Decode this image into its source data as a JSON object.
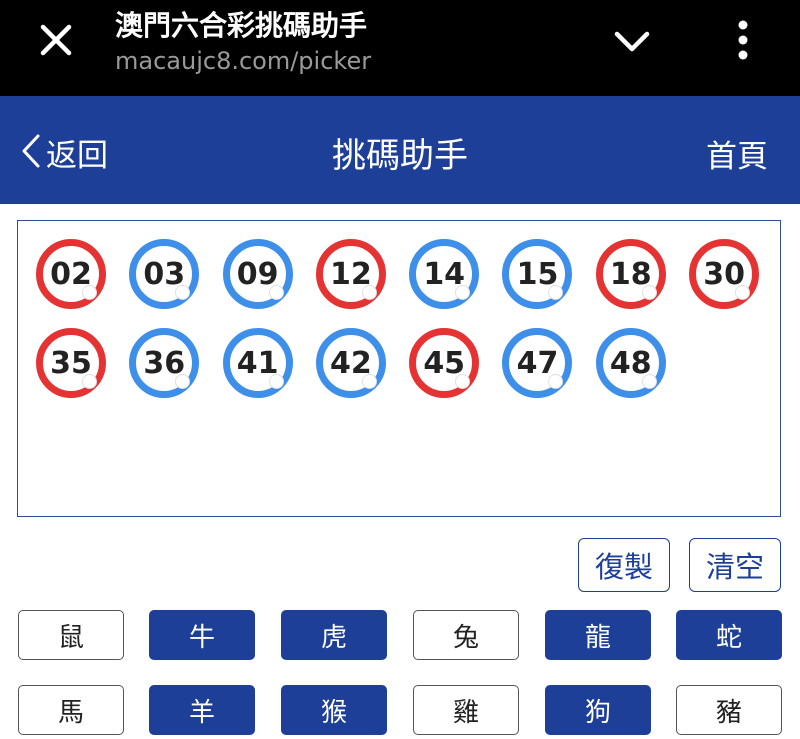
{
  "browser": {
    "title": "澳門六合彩挑碼助手",
    "url": "macaujc8.com/picker"
  },
  "header": {
    "back_label": "返回",
    "title": "挑碼助手",
    "home_label": "首頁"
  },
  "balls": [
    {
      "number": "02",
      "color": "red"
    },
    {
      "number": "03",
      "color": "blue"
    },
    {
      "number": "09",
      "color": "blue"
    },
    {
      "number": "12",
      "color": "red"
    },
    {
      "number": "14",
      "color": "blue"
    },
    {
      "number": "15",
      "color": "blue"
    },
    {
      "number": "18",
      "color": "red"
    },
    {
      "number": "30",
      "color": "red"
    },
    {
      "number": "35",
      "color": "red"
    },
    {
      "number": "36",
      "color": "blue"
    },
    {
      "number": "41",
      "color": "blue"
    },
    {
      "number": "42",
      "color": "blue"
    },
    {
      "number": "45",
      "color": "red"
    },
    {
      "number": "47",
      "color": "blue"
    },
    {
      "number": "48",
      "color": "blue"
    }
  ],
  "actions": {
    "copy_label": "復製",
    "clear_label": "清空"
  },
  "zodiac": [
    {
      "label": "鼠",
      "selected": false
    },
    {
      "label": "牛",
      "selected": true
    },
    {
      "label": "虎",
      "selected": true
    },
    {
      "label": "兔",
      "selected": false
    },
    {
      "label": "龍",
      "selected": true
    },
    {
      "label": "蛇",
      "selected": true
    },
    {
      "label": "馬",
      "selected": false
    },
    {
      "label": "羊",
      "selected": true
    },
    {
      "label": "猴",
      "selected": true
    },
    {
      "label": "雞",
      "selected": false
    },
    {
      "label": "狗",
      "selected": true
    },
    {
      "label": "豬",
      "selected": false
    }
  ],
  "colors": {
    "brand_blue": "#1d3f98",
    "ball_red": "#e53333",
    "ball_blue": "#3d8fea"
  }
}
